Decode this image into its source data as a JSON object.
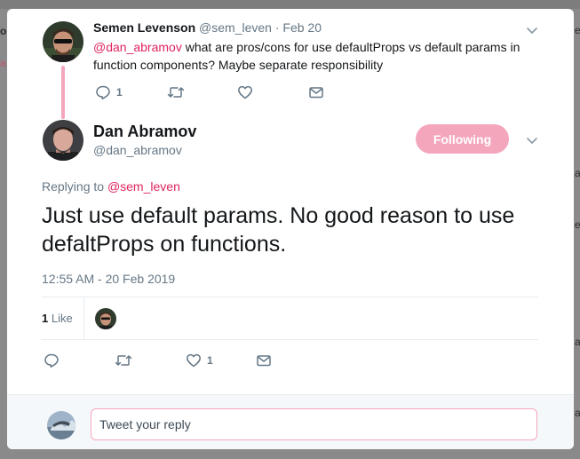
{
  "colors": {
    "accent": "#e0245e",
    "accent_light": "#f4a6bd",
    "text_primary": "#14171a",
    "text_secondary": "#657786",
    "divider": "#e6ecf0"
  },
  "backdrop": {
    "left_edge_glyphs": [
      "o",
      "a"
    ],
    "right_edge_glyphs": [
      "e",
      "a",
      "e",
      "a",
      "a"
    ]
  },
  "parent_tweet": {
    "author_name": "Semen Levenson",
    "author_handle": "@sem_leven",
    "separator": "·",
    "date": "Feb 20",
    "mention": "@dan_abramov",
    "text": " what are pros/cons for use defaultProps vs default params in function components? Maybe separate responsibility",
    "reply_count": "1",
    "icons": [
      "reply-icon",
      "retweet-icon",
      "like-icon",
      "message-icon",
      "chevron-down-icon"
    ]
  },
  "main_tweet": {
    "author_name": "Dan Abramov",
    "author_handle": "@dan_abramov",
    "follow_label": "Following",
    "replying_prefix": "Replying to ",
    "replying_to": "@sem_leven",
    "text": "Just use default params. No good reason to use defaltProps on functions.",
    "timestamp": "12:55 AM - 20 Feb 2019",
    "likes_count": "1",
    "likes_label": " Like",
    "like_action_count": "1",
    "icons": [
      "reply-icon",
      "retweet-icon",
      "like-icon",
      "message-icon",
      "chevron-down-icon"
    ]
  },
  "reply_bar": {
    "placeholder": "Tweet your reply"
  }
}
